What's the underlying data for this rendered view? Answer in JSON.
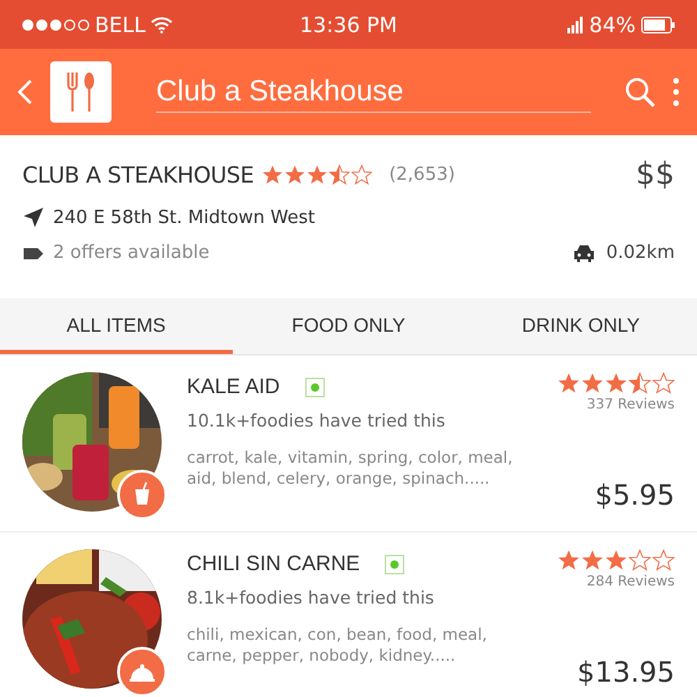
{
  "status_bar": {
    "carrier": "BELL",
    "time": "13:36 PM",
    "battery": "84%"
  },
  "header": {
    "title": "Club a Steakhouse"
  },
  "restaurant": {
    "name": "CLUB A STEAKHOUSE",
    "stars": 3.5,
    "review_count": "(2,653)",
    "price_level": "$$",
    "address": "240 E 58th St. Midtown West",
    "offers": "2 offers available",
    "distance": "0.02km"
  },
  "tabs": [
    {
      "label": "ALL ITEMS",
      "selected": true
    },
    {
      "label": "FOOD ONLY",
      "selected": false
    },
    {
      "label": "DRINK ONLY",
      "selected": false
    }
  ],
  "items": [
    {
      "kind": "drink",
      "name": "KALE AID",
      "veg": true,
      "tried": "10.1k+foodies have tried this",
      "tags": "carrot, kale, vitamin, spring, color,  meal, aid, blend, celery, orange, spinach.....",
      "stars": 3.5,
      "reviews": "337 Reviews",
      "price": "$5.95"
    },
    {
      "kind": "food",
      "name": "CHILI SIN CARNE",
      "veg": true,
      "tried": "8.1k+foodies have tried this",
      "tags": "chili, mexican, con, bean, food, meal, carne, pepper, nobody, kidney.....",
      "stars": 3,
      "reviews": "284 Reviews",
      "price": "$13.95"
    }
  ]
}
